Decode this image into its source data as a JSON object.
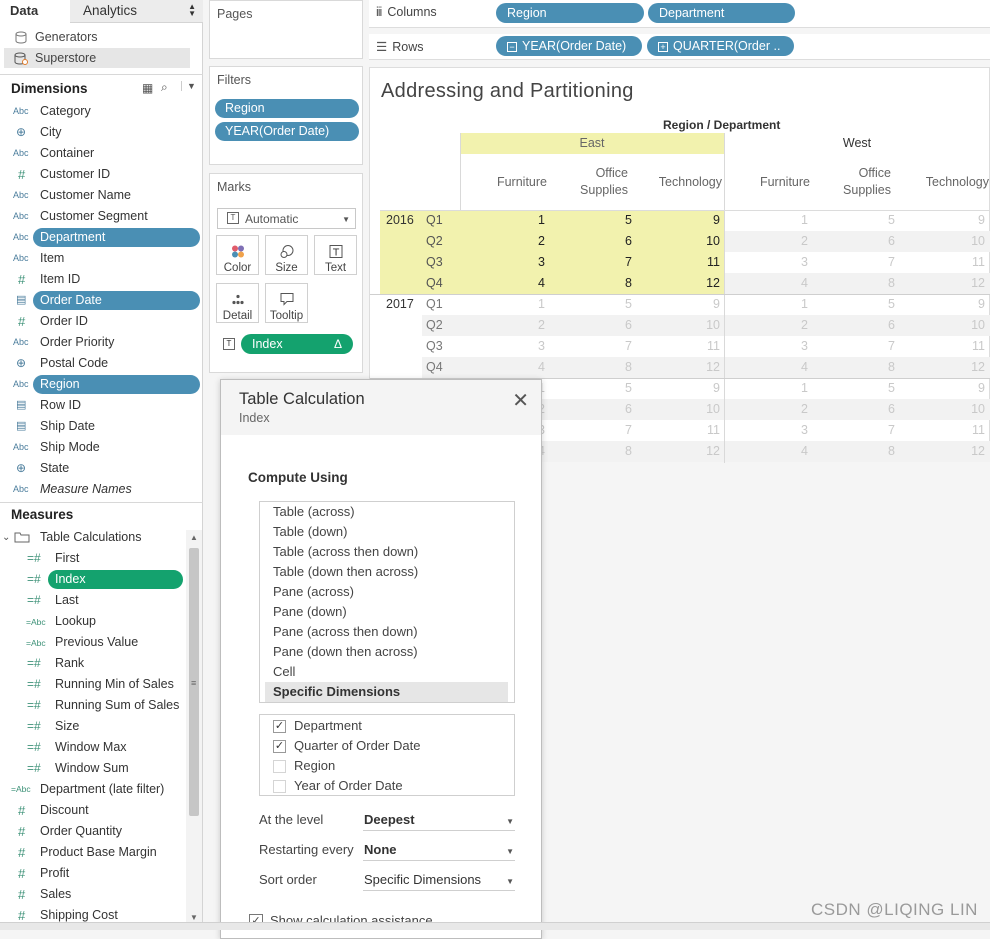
{
  "tabs": {
    "data": "Data",
    "analytics": "Analytics"
  },
  "datasources": [
    "Generators",
    "Superstore"
  ],
  "dimensions": {
    "title": "Dimensions",
    "items": [
      {
        "label": "Category",
        "type": "Abc"
      },
      {
        "label": "City",
        "type": "geo"
      },
      {
        "label": "Container",
        "type": "Abc"
      },
      {
        "label": "Customer ID",
        "type": "#"
      },
      {
        "label": "Customer Name",
        "type": "Abc"
      },
      {
        "label": "Customer Segment",
        "type": "Abc"
      },
      {
        "label": "Department",
        "type": "Abc",
        "inuse": true
      },
      {
        "label": "Item",
        "type": "Abc"
      },
      {
        "label": "Item ID",
        "type": "#"
      },
      {
        "label": "Order Date",
        "type": "date",
        "inuse": true
      },
      {
        "label": "Order ID",
        "type": "#"
      },
      {
        "label": "Order Priority",
        "type": "Abc"
      },
      {
        "label": "Postal Code",
        "type": "geo"
      },
      {
        "label": "Region",
        "type": "Abc",
        "inuse": true
      },
      {
        "label": "Row ID",
        "type": "date"
      },
      {
        "label": "Ship Date",
        "type": "date"
      },
      {
        "label": "Ship Mode",
        "type": "Abc"
      },
      {
        "label": "State",
        "type": "geo"
      },
      {
        "label": "Measure Names",
        "type": "Abc"
      }
    ]
  },
  "measures": {
    "title": "Measures",
    "folder": "Table Calculations",
    "table_calcs": [
      {
        "label": "First",
        "type": "=#"
      },
      {
        "label": "Index",
        "type": "=#",
        "inuse": true
      },
      {
        "label": "Last",
        "type": "=#"
      },
      {
        "label": "Lookup",
        "type": "=Abc"
      },
      {
        "label": "Previous Value",
        "type": "=Abc"
      },
      {
        "label": "Rank",
        "type": "=#"
      },
      {
        "label": "Running Min of Sales",
        "type": "=#"
      },
      {
        "label": "Running Sum of Sales",
        "type": "=#"
      },
      {
        "label": "Size",
        "type": "=#"
      },
      {
        "label": "Window Max",
        "type": "=#"
      },
      {
        "label": "Window Sum",
        "type": "=#"
      }
    ],
    "items": [
      {
        "label": "Department (late filter)",
        "type": "=Abc"
      },
      {
        "label": "Discount",
        "type": "#"
      },
      {
        "label": "Order Quantity",
        "type": "#"
      },
      {
        "label": "Product Base Margin",
        "type": "#"
      },
      {
        "label": "Profit",
        "type": "#"
      },
      {
        "label": "Sales",
        "type": "#"
      },
      {
        "label": "Shipping Cost",
        "type": "#"
      }
    ]
  },
  "pages": {
    "title": "Pages"
  },
  "filters": {
    "title": "Filters",
    "items": [
      "Region",
      "YEAR(Order Date)"
    ]
  },
  "marks": {
    "title": "Marks",
    "type": "Automatic",
    "buttons": [
      "Color",
      "Size",
      "Text",
      "Detail",
      "Tooltip"
    ],
    "pill": "Index",
    "pill_delta": "Δ"
  },
  "columns": {
    "label": "Columns",
    "pills": [
      "Region",
      "Department"
    ]
  },
  "rows": {
    "label": "Rows",
    "pills": [
      "YEAR(Order Date)",
      "QUARTER(Order .."
    ]
  },
  "viz": {
    "title": "Addressing and Partitioning",
    "header": "Region / Department",
    "regions": [
      "East",
      "West"
    ],
    "departments": [
      [
        "Furniture"
      ],
      [
        "Office",
        "Supplies"
      ],
      [
        "Technology"
      ]
    ],
    "years": [
      "2016",
      "2017"
    ],
    "quarters": [
      "Q1",
      "Q2",
      "Q3",
      "Q4"
    ]
  },
  "table": {
    "rows": [
      [
        1,
        5,
        9,
        1,
        5,
        9
      ],
      [
        2,
        6,
        10,
        2,
        6,
        10
      ],
      [
        3,
        7,
        11,
        3,
        7,
        11
      ],
      [
        4,
        8,
        12,
        4,
        8,
        12
      ],
      [
        1,
        5,
        9,
        1,
        5,
        9
      ],
      [
        2,
        6,
        10,
        2,
        6,
        10
      ],
      [
        3,
        7,
        11,
        3,
        7,
        11
      ],
      [
        4,
        8,
        12,
        4,
        8,
        12
      ],
      [
        1,
        5,
        9,
        1,
        5,
        9
      ],
      [
        2,
        6,
        10,
        2,
        6,
        10
      ],
      [
        3,
        7,
        11,
        3,
        7,
        11
      ],
      [
        4,
        8,
        12,
        4,
        8,
        12
      ]
    ]
  },
  "dialog": {
    "title": "Table Calculation",
    "subtitle": "Index",
    "compute_label": "Compute Using",
    "options": [
      "Table (across)",
      "Table (down)",
      "Table (across then down)",
      "Table (down then across)",
      "Pane (across)",
      "Pane (down)",
      "Pane (across then down)",
      "Pane (down then across)",
      "Cell",
      "Specific Dimensions"
    ],
    "selected": "Specific Dimensions",
    "dims": [
      {
        "label": "Department",
        "checked": true
      },
      {
        "label": "Quarter of Order Date",
        "checked": true
      },
      {
        "label": "Region",
        "checked": false
      },
      {
        "label": "Year of Order Date",
        "checked": false
      }
    ],
    "level_label": "At the level",
    "level_value": "Deepest",
    "restart_label": "Restarting every",
    "restart_value": "None",
    "sort_label": "Sort order",
    "sort_value": "Specific Dimensions",
    "assist_label": "Show calculation assistance"
  },
  "watermark": "CSDN @LIQING LIN"
}
